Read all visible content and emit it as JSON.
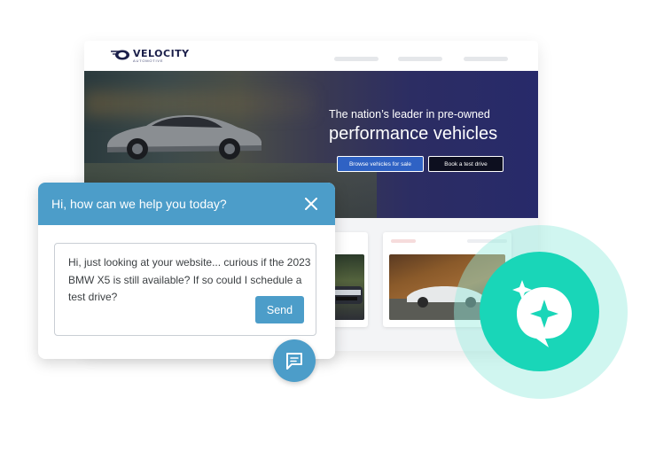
{
  "site": {
    "logo": {
      "name": "VELOCITY",
      "sub": "AUTOMOTIVE"
    },
    "hero": {
      "subtitle": "The nation’s leader in pre-owned",
      "title": "performance vehicles",
      "primary_button": "Browse vehicles for sale",
      "secondary_button": "Book a test drive"
    },
    "colors": {
      "hero_gradient_end": "#272a6a",
      "primary_button": "#2f62c4",
      "card_pill_pink": "#f6dcdc"
    }
  },
  "chat": {
    "title": "Hi, how can we help you today?",
    "message": "Hi, just looking at your website... curious if the 2023 BMW X5 is still available? If so could I schedule a test drive?",
    "send_label": "Send",
    "icons": {
      "close": "close-icon",
      "chat": "chat-bubble-icon"
    },
    "colors": {
      "header": "#4c9dc9"
    }
  },
  "ai_assistant": {
    "icon": "sparkle-chat-icon",
    "colors": {
      "inner": "#19d6b8",
      "halo": "#96ecde"
    }
  }
}
